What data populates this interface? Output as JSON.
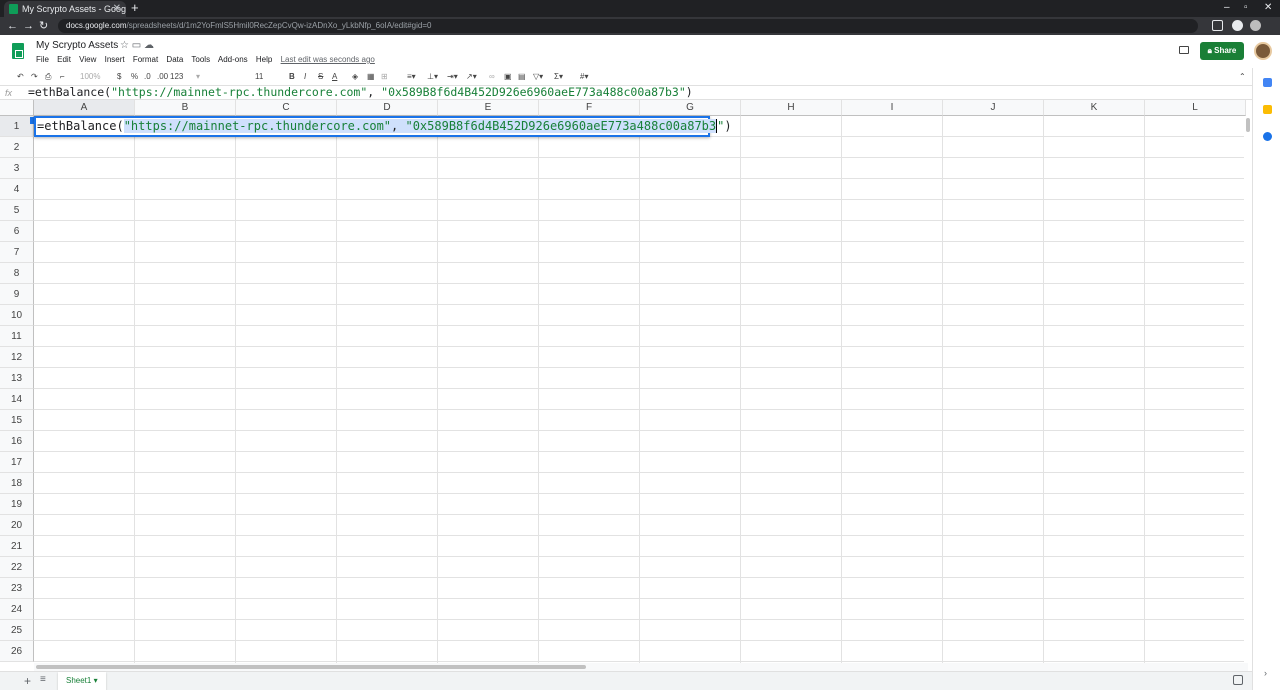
{
  "browser": {
    "tab_title": "My Scrypto Assets - Googl",
    "tab_close": "✕",
    "new_tab": "+",
    "url_host": "docs.google.com",
    "url_path": "/spreadsheets/d/1m2YoFmlS5Hmil0RecZepCvQw-izADnXo_yLkbNfp_6oIA/edit#gid=0",
    "controls": [
      "–",
      "▫",
      "✕"
    ]
  },
  "doc": {
    "title": "My Scrypto Assets",
    "menus": [
      "File",
      "Edit",
      "View",
      "Insert",
      "Format",
      "Data",
      "Tools",
      "Add-ons",
      "Help"
    ],
    "last_edit": "Last edit was seconds ago",
    "share_label": "Share"
  },
  "toolbar": {
    "zoom": "100%",
    "currency": "$",
    "percent": "%",
    "dec_less": ".0",
    "dec_more": ".00",
    "number_format": "123",
    "font_size": "11",
    "bold": "B",
    "italic": "I",
    "strike": "S",
    "text_color": "A"
  },
  "formula_bar": {
    "fx": "fx",
    "prefix": "=ethBalance(",
    "arg1": "\"https://mainnet-rpc.thundercore.com\"",
    "sep": ", ",
    "arg2": "\"0x589B8f6d4B452D926e6960aeE773a488c00a87b3\"",
    "suffix": ")"
  },
  "grid": {
    "columns": [
      "A",
      "B",
      "C",
      "D",
      "E",
      "F",
      "G",
      "H",
      "I",
      "J",
      "K",
      "L"
    ],
    "rows": [
      "1",
      "2",
      "3",
      "4",
      "5",
      "6",
      "7",
      "8",
      "9",
      "10",
      "11",
      "12",
      "13",
      "14",
      "15",
      "16",
      "17",
      "18",
      "19",
      "20",
      "21",
      "22",
      "23",
      "24",
      "25",
      "26"
    ],
    "active_cell": "A1"
  },
  "editor": {
    "prefix": "=ethBalance(",
    "arg1": "\"https://mainnet-rpc.thundercore.com\"",
    "sep": ", ",
    "arg2_main": "\"0x589B8f6d4B452D926e6960aeE773a488c00a87b3",
    "arg2_close": "\"",
    "suffix": ")"
  },
  "sheets": {
    "add": "+",
    "list": "≡",
    "tabs": [
      {
        "label": "Sheet1 ▾"
      }
    ]
  },
  "colors": {
    "accent": "#1a73e8",
    "share": "#1a7f37",
    "string": "#188038"
  }
}
